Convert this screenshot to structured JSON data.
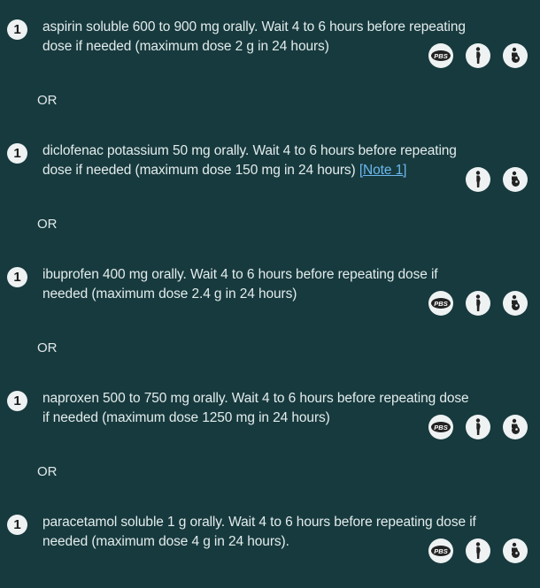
{
  "connector_label": "OR",
  "icons": {
    "pbs_text": "PBS",
    "pbs": "pbs-icon",
    "pregnancy": "pregnancy-icon",
    "breastfeeding": "breastfeeding-icon"
  },
  "entries": [
    {
      "step": "1",
      "line1": "aspirin soluble 600 to 900 mg orally. Wait 4 to 6 hours before repeating",
      "line2": "dose if needed (maximum dose 2 g in 24 hours)",
      "note": "",
      "show_pbs": true
    },
    {
      "step": "1",
      "line1": "diclofenac potassium 50 mg orally. Wait 4 to 6 hours before repeating",
      "line2": "dose if needed (maximum dose 150 mg in 24 hours)",
      "note": "[Note 1]",
      "show_pbs": false
    },
    {
      "step": "1",
      "line1": "ibuprofen 400 mg orally. Wait 4 to 6 hours before repeating dose if",
      "line2": "needed (maximum dose 2.4 g in 24 hours)",
      "note": "",
      "show_pbs": true
    },
    {
      "step": "1",
      "line1": "naproxen 500 to 750 mg orally. Wait 4 to 6 hours before repeating dose",
      "line2": "if needed (maximum dose 1250 mg in 24 hours)",
      "note": "",
      "show_pbs": true
    },
    {
      "step": "1",
      "line1": "paracetamol soluble 1 g orally. Wait 4 to 6 hours before repeating dose if",
      "line2": "needed (maximum dose 4 g in 24 hours).",
      "note": "",
      "show_pbs": true
    }
  ]
}
